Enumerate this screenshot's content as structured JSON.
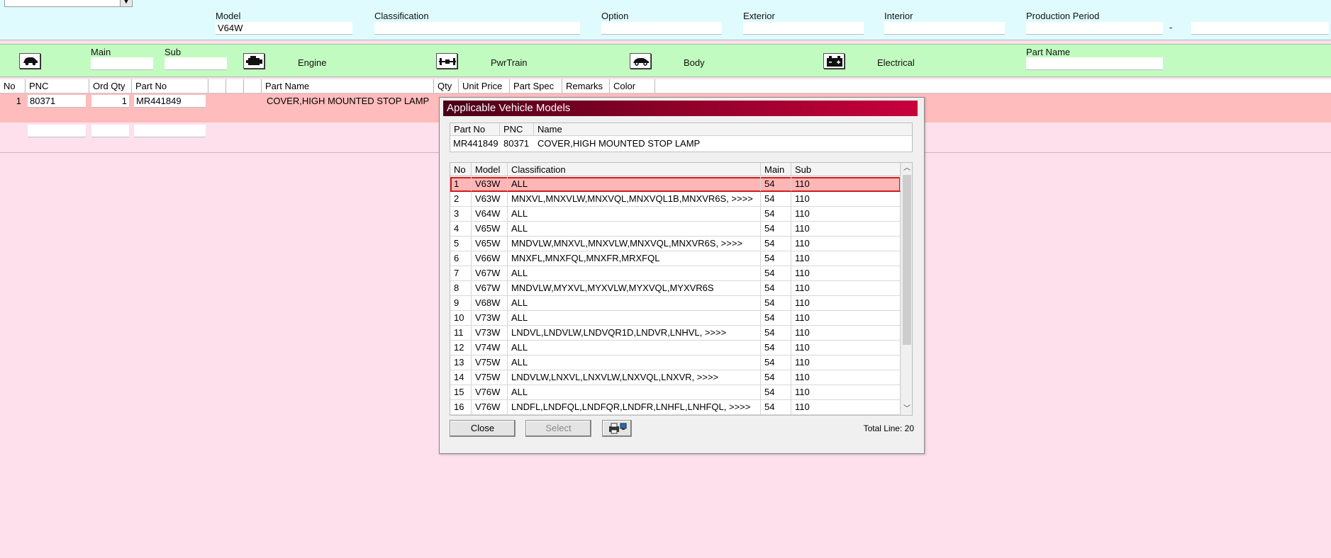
{
  "header": {
    "model_label": "Model",
    "model_value": "V64W",
    "classification_label": "Classification",
    "option_label": "Option",
    "exterior_label": "Exterior",
    "interior_label": "Interior",
    "production_period_label": "Production Period",
    "period_separator": "-"
  },
  "categories": {
    "main_label": "Main",
    "sub_label": "Sub",
    "part_name_label": "Part Name",
    "engine": "Engine",
    "pwrtrain": "PwrTrain",
    "body": "Body",
    "electrical": "Electrical"
  },
  "grid": {
    "columns": [
      "No",
      "PNC",
      "Ord Qty",
      "Part No",
      "",
      "",
      "",
      "Part Name",
      "Qty",
      "Unit Price",
      "Part Spec",
      "Remarks",
      "Color"
    ],
    "rows": [
      {
        "no": "1",
        "pnc": "80371",
        "ord_qty": "1",
        "part_no": "MR441849",
        "part_name": "COVER,HIGH MOUNTED STOP LAMP"
      }
    ]
  },
  "dialog": {
    "title": "Applicable Vehicle Models",
    "info_headers": [
      "Part No",
      "PNC",
      "Name"
    ],
    "info_values": {
      "part_no": "MR441849",
      "pnc": "80371",
      "name": "COVER,HIGH MOUNTED STOP LAMP"
    },
    "table_headers": [
      "No",
      "Model",
      "Classification",
      "Main",
      "Sub"
    ],
    "rows": [
      {
        "no": "1",
        "model": "V63W",
        "classification": "ALL",
        "main": "54",
        "sub": "110"
      },
      {
        "no": "2",
        "model": "V63W",
        "classification": "MNXVL,MNXVLW,MNXVQL,MNXVQL1B,MNXVR6S,  >>>>",
        "main": "54",
        "sub": "110"
      },
      {
        "no": "3",
        "model": "V64W",
        "classification": "ALL",
        "main": "54",
        "sub": "110"
      },
      {
        "no": "4",
        "model": "V65W",
        "classification": "ALL",
        "main": "54",
        "sub": "110"
      },
      {
        "no": "5",
        "model": "V65W",
        "classification": "MNDVLW,MNXVL,MNXVLW,MNXVQL,MNXVR6S,  >>>>",
        "main": "54",
        "sub": "110"
      },
      {
        "no": "6",
        "model": "V66W",
        "classification": "MNXFL,MNXFQL,MNXFR,MRXFQL",
        "main": "54",
        "sub": "110"
      },
      {
        "no": "7",
        "model": "V67W",
        "classification": "ALL",
        "main": "54",
        "sub": "110"
      },
      {
        "no": "8",
        "model": "V67W",
        "classification": "MNDVLW,MYXVL,MYXVLW,MYXVQL,MYXVR6S",
        "main": "54",
        "sub": "110"
      },
      {
        "no": "9",
        "model": "V68W",
        "classification": "ALL",
        "main": "54",
        "sub": "110"
      },
      {
        "no": "10",
        "model": "V73W",
        "classification": "ALL",
        "main": "54",
        "sub": "110"
      },
      {
        "no": "11",
        "model": "V73W",
        "classification": "LNDVL,LNDVLW,LNDVQR1D,LNDVR,LNHVL,  >>>>",
        "main": "54",
        "sub": "110"
      },
      {
        "no": "12",
        "model": "V74W",
        "classification": "ALL",
        "main": "54",
        "sub": "110"
      },
      {
        "no": "13",
        "model": "V75W",
        "classification": "ALL",
        "main": "54",
        "sub": "110"
      },
      {
        "no": "14",
        "model": "V75W",
        "classification": "LNDVLW,LNXVL,LNXVLW,LNXVQL,LNXVR,  >>>>",
        "main": "54",
        "sub": "110"
      },
      {
        "no": "15",
        "model": "V76W",
        "classification": "ALL",
        "main": "54",
        "sub": "110"
      },
      {
        "no": "16",
        "model": "V76W",
        "classification": "LNDFL,LNDFQL,LNDFQR,LNDFR,LNHFL,LNHFQL,  >>>>",
        "main": "54",
        "sub": "110"
      }
    ],
    "close_label": "Close",
    "select_label": "Select",
    "total_line": "Total Line: 20"
  },
  "colors": {
    "title_gradient_start": "#4a0018",
    "title_gradient_end": "#c8003c",
    "selected_row": "#ffb6b6",
    "selected_border": "#d01b1b",
    "page_bg": "#fde0ec",
    "header_bg": "#e0fbfd",
    "category_bg": "#c2fbc0"
  }
}
